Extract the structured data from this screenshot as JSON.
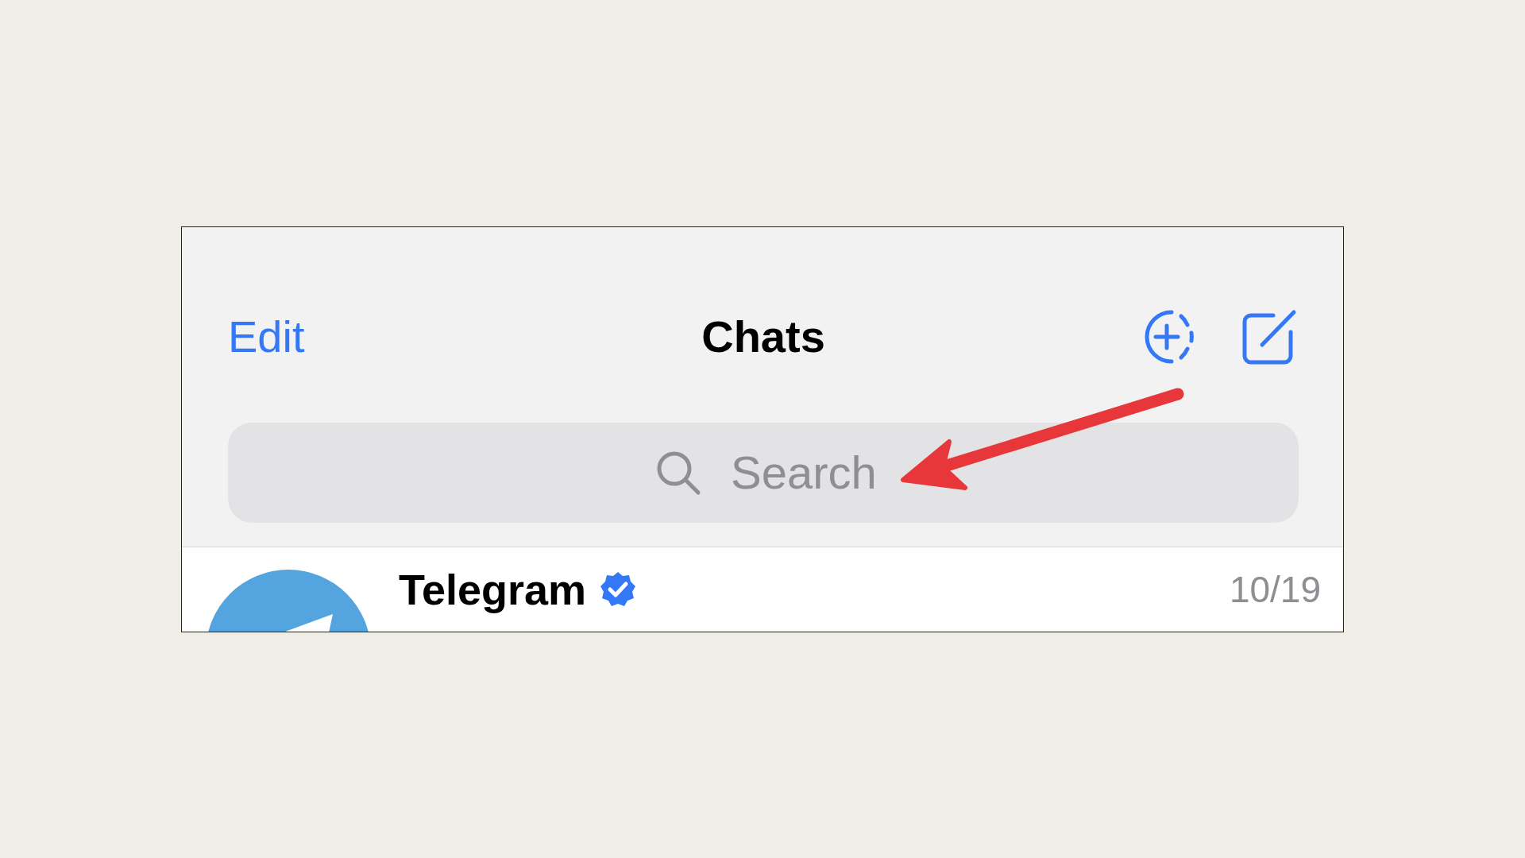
{
  "nav_bar": {
    "edit": "Edit",
    "title": "Chats"
  },
  "search": {
    "placeholder": "Search"
  },
  "chats": [
    {
      "name": "Telegram",
      "verified": true,
      "date": "10/19"
    }
  ]
}
